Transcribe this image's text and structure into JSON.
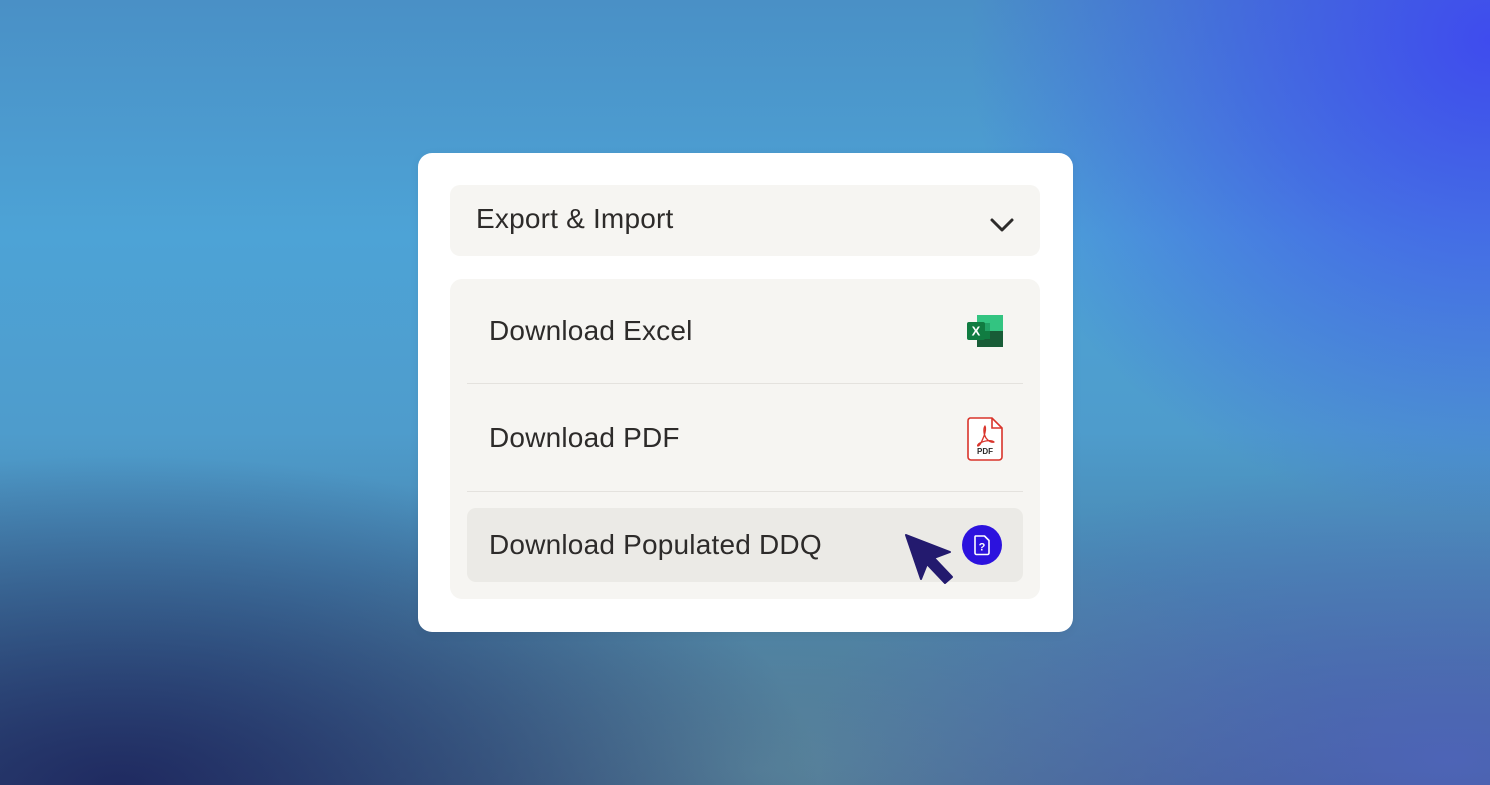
{
  "panel": {
    "title": "Export & Import",
    "chevron_icon": "chevron-down-icon"
  },
  "menu": {
    "items": [
      {
        "label": "Download Excel",
        "icon": "excel-icon",
        "icon_text": "X"
      },
      {
        "label": "Download PDF",
        "icon": "pdf-icon",
        "icon_text": "PDF"
      },
      {
        "label": "Download Populated DDQ",
        "icon": "ddq-question-icon",
        "icon_text": "?",
        "state": "hovered"
      }
    ]
  },
  "colors": {
    "panel_bg": "#f6f5f2",
    "hover_bg": "#ebeae6",
    "text": "#2d2b2a",
    "accent": "#2c12de",
    "excel_green": "#1f7a45",
    "pdf_red": "#d9342b",
    "cursor": "#231a6e"
  },
  "cursor_icon": "mouse-pointer-icon"
}
